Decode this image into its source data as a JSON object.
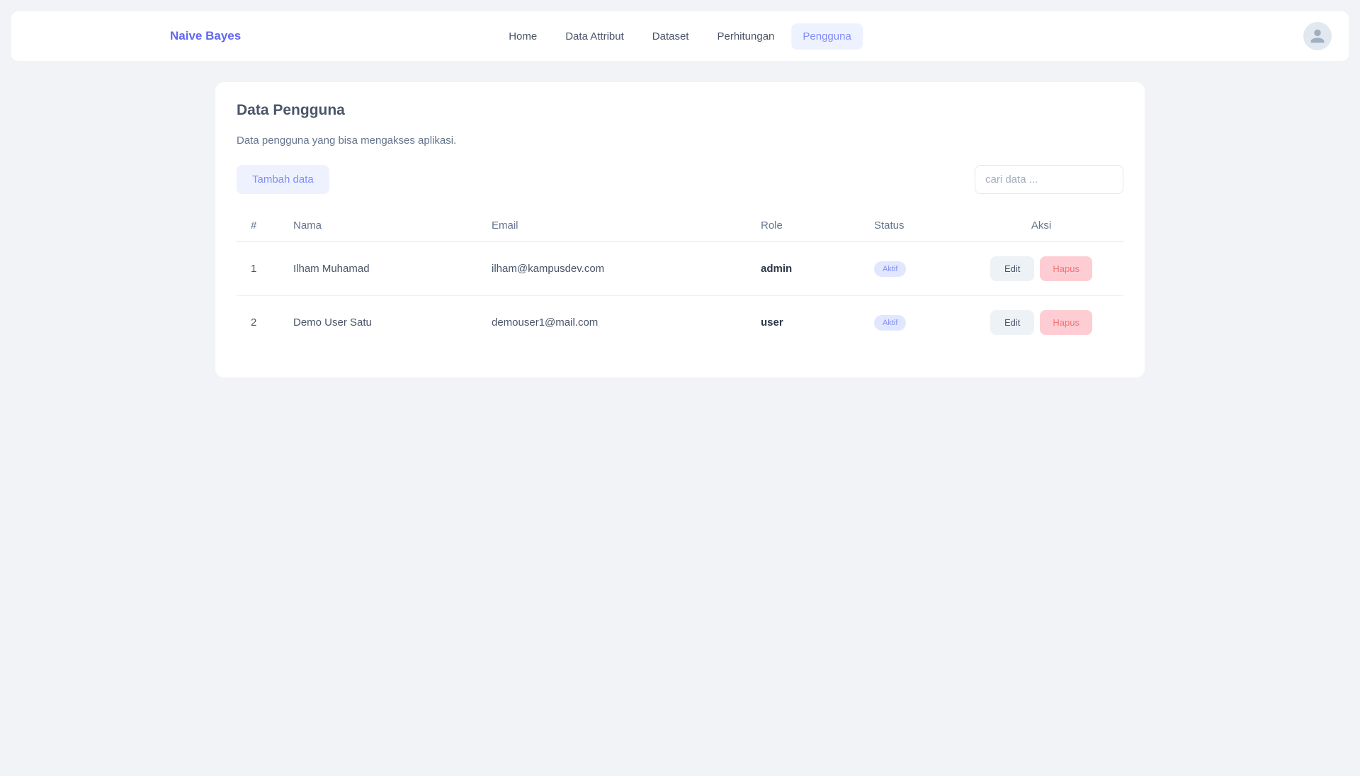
{
  "brand": "Naive Bayes",
  "nav": {
    "items": [
      {
        "label": "Home",
        "active": false
      },
      {
        "label": "Data Attribut",
        "active": false
      },
      {
        "label": "Dataset",
        "active": false
      },
      {
        "label": "Perhitungan",
        "active": false
      },
      {
        "label": "Pengguna",
        "active": true
      }
    ]
  },
  "page": {
    "title": "Data Pengguna",
    "subtitle": "Data pengguna yang bisa mengakses aplikasi."
  },
  "toolbar": {
    "add_label": "Tambah data",
    "search_placeholder": "cari data ..."
  },
  "table": {
    "headers": {
      "num": "#",
      "name": "Nama",
      "email": "Email",
      "role": "Role",
      "status": "Status",
      "action": "Aksi"
    },
    "rows": [
      {
        "num": "1",
        "name": "Ilham Muhamad",
        "email": "ilham@kampusdev.com",
        "role": "admin",
        "status": "Aktif"
      },
      {
        "num": "2",
        "name": "Demo User Satu",
        "email": "demouser1@mail.com",
        "role": "user",
        "status": "Aktif"
      }
    ]
  },
  "buttons": {
    "edit": "Edit",
    "delete": "Hapus"
  }
}
